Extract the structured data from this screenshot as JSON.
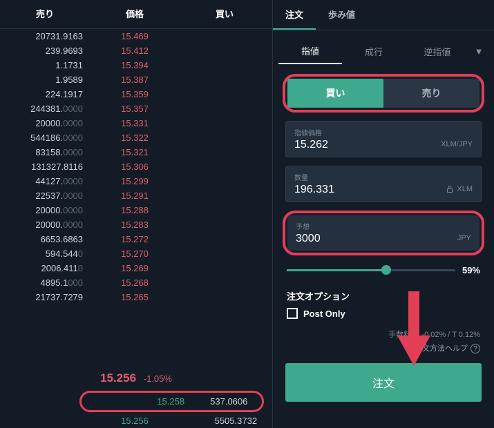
{
  "orderbook": {
    "header": {
      "sell": "売り",
      "price": "価格",
      "buy": "買い"
    },
    "asks": [
      {
        "amt": "20731.9163",
        "price": "15.469"
      },
      {
        "amt": "239.9693",
        "price": "15.412"
      },
      {
        "amt": "1.1731",
        "price": "15.394"
      },
      {
        "amt": "1.9589",
        "price": "15.387"
      },
      {
        "amt": "224.1917",
        "price": "15.359"
      },
      {
        "amt": "244381.0000",
        "price": "15.357"
      },
      {
        "amt": "20000.0000",
        "price": "15.331"
      },
      {
        "amt": "544186.0000",
        "price": "15.322"
      },
      {
        "amt": "83158.0000",
        "price": "15.321"
      },
      {
        "amt": "131327.8116",
        "price": "15.306"
      },
      {
        "amt": "44127.0000",
        "price": "15.299"
      },
      {
        "amt": "22537.0000",
        "price": "15.291"
      },
      {
        "amt": "20000.0000",
        "price": "15.288"
      },
      {
        "amt": "20000.0000",
        "price": "15.283"
      },
      {
        "amt": "6653.6863",
        "price": "15.272"
      },
      {
        "amt": "594.5440",
        "price": "15.270"
      },
      {
        "amt": "2006.4110",
        "price": "15.269"
      },
      {
        "amt": "4895.1000",
        "price": "15.268"
      },
      {
        "amt": "21737.7279",
        "price": "15.265"
      }
    ],
    "mid": {
      "price": "15.256",
      "change": "-1.05%"
    },
    "bids": [
      {
        "price": "15.258",
        "amt": "537.0606"
      },
      {
        "price": "15.256",
        "amt": "5505.3732"
      }
    ]
  },
  "top_tabs": {
    "order": "注文",
    "history": "歩み値"
  },
  "sub_tabs": {
    "limit": "指値",
    "market": "成行",
    "stop": "逆指値"
  },
  "side": {
    "buy": "買い",
    "sell": "売り"
  },
  "fields": {
    "price": {
      "label": "指値価格",
      "value": "15.262",
      "unit": "XLM/JPY"
    },
    "qty": {
      "label": "数量",
      "value": "196.331",
      "unit": "XLM"
    },
    "est": {
      "label": "予想",
      "value": "3000",
      "unit": "JPY"
    }
  },
  "slider_pct": "59%",
  "options": {
    "title": "注文オプション",
    "postonly": "Post Only"
  },
  "fee_text": "手数料 M -0.02% / T 0.12%",
  "help_text": "注文方法ヘルプ",
  "submit": "注文"
}
